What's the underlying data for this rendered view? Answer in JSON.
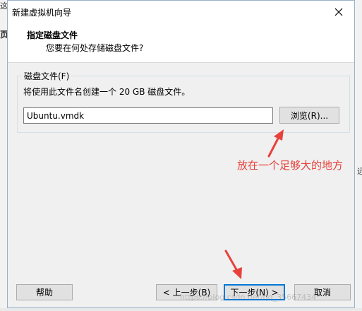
{
  "background": {
    "left_top_label": "这",
    "left_mid_label": "页",
    "right_mid_label": "远"
  },
  "dialog": {
    "title": "新建虚拟机向导",
    "header_title": "指定磁盘文件",
    "header_subtitle": "您要在何处存储磁盘文件?",
    "group_label": "磁盘文件(F)",
    "group_description": "将使用此文件名创建一个 20 GB 磁盘文件。",
    "file_value": "Ubuntu.vmdk",
    "browse_label": "浏览(R)...",
    "help_label": "帮助",
    "back_label": "< 上一步(B)",
    "next_label": "下一步(N) >",
    "cancel_label": "取消"
  },
  "annotation": {
    "text": "放在一个足够大的地方",
    "color": "#e8413b"
  },
  "watermark": "https://blog.csdn.net/qq_35667434",
  "icons": {
    "close": "close-icon",
    "arrow": "red-arrow-icon"
  }
}
